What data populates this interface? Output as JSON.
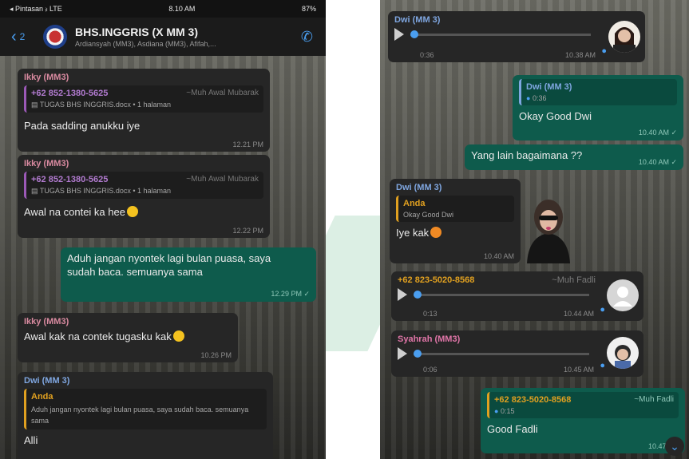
{
  "colors": {
    "accent": "#4a9ef0",
    "outgoing_bubble": "#0e5b4c",
    "incoming_bubble": "#262626"
  },
  "left": {
    "statusbar": {
      "carrier": "◂ Pintasan ᵢₗ LTE",
      "time": "8.10 AM",
      "battery": "87%"
    },
    "header": {
      "back_count": "2",
      "title": "BHS.INGGRIS (X MM 3)",
      "members": "Ardiansyah (MM3), Asdiana (MM3), Afifah,..."
    },
    "msg1": {
      "sender": "Ikky (MM3)",
      "quote_number": "+62 852-1380-5625",
      "quote_via": "~Muh Awal Mubarak",
      "quote_file": "TUGAS BHS INGGRIS.docx • 1 halaman",
      "text": "Pada sadding anukku iye",
      "time": "12.21 PM"
    },
    "msg2": {
      "sender": "Ikky (MM3)",
      "quote_number": "+62 852-1380-5625",
      "quote_via": "~Muh Awal Mubarak",
      "quote_file": "TUGAS BHS INGGRIS.docx • 1 halaman",
      "text": "Awal na contei ka hee",
      "time": "12.22 PM"
    },
    "msg3": {
      "text": "Aduh jangan nyontek lagi bulan puasa, saya sudah baca.  semuanya sama",
      "time": "12.29 PM ✓"
    },
    "msg4": {
      "sender": "Ikky (MM3)",
      "text": "Awal kak na contek tugasku kak",
      "time": "10.26 PM"
    },
    "msg5": {
      "sender": "Dwi (MM 3)",
      "quote_name": "Anda",
      "quote_text": "Aduh jangan nyontek lagi bulan puasa, saya sudah baca.  semuanya sama",
      "text": "Alli"
    }
  },
  "right": {
    "msg1": {
      "sender": "Dwi (MM 3)",
      "duration": "0:36",
      "time": "10.38 AM"
    },
    "msg2": {
      "quote_name": "Dwi (MM 3)",
      "quote_audio": "0:36",
      "text": "Okay Good Dwi",
      "time": "10.40 AM ✓"
    },
    "msg3": {
      "text": "Yang lain bagaimana ??",
      "time": "10.40 AM ✓"
    },
    "msg4": {
      "sender": "Dwi (MM 3)",
      "quote_name": "Anda",
      "quote_text": "Okay Good Dwi",
      "text": "Iye kak",
      "time": "10.40 AM"
    },
    "msg5": {
      "sender": "+62 823-5020-8568",
      "via": "~Muh Fadli",
      "duration": "0:13",
      "time": "10.44 AM"
    },
    "msg6": {
      "sender": "Syahrah (MM3)",
      "duration": "0:06",
      "time": "10.45 AM"
    },
    "msg7": {
      "quote_name": "+62 823-5020-8568",
      "quote_via": "~Muh Fadli",
      "quote_audio": "0:15",
      "text": "Good Fadli",
      "time": "10.47 AM"
    }
  }
}
